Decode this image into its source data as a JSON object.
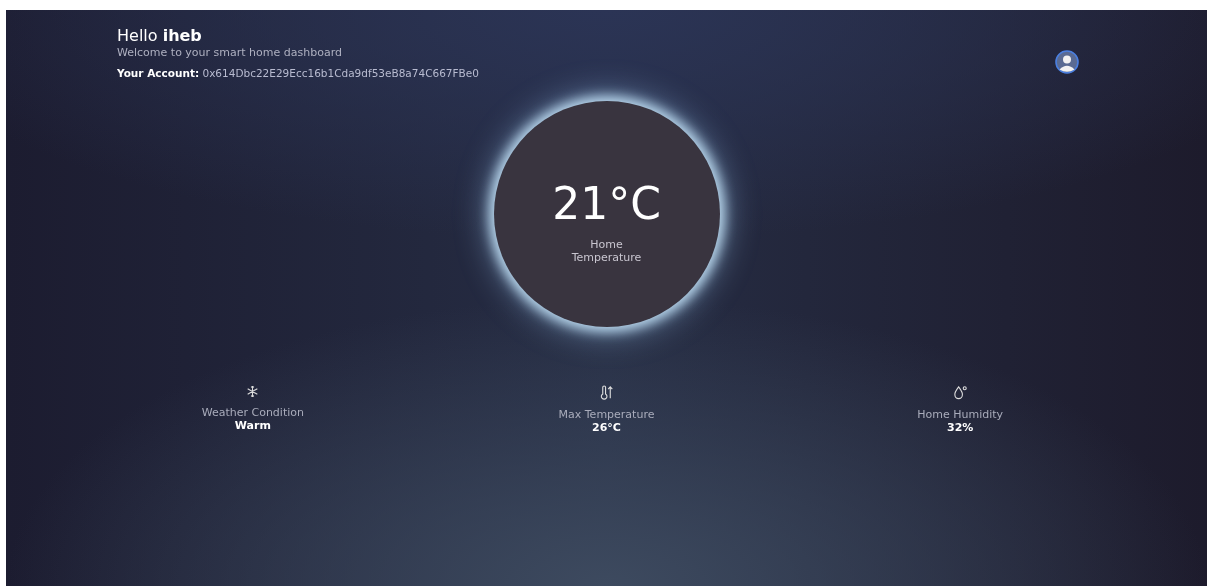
{
  "greeting": {
    "text": "Hello",
    "name": "iheb"
  },
  "subtitle": "Welcome to your smart home dashboard",
  "account": {
    "label": "Your Account:",
    "value": "0x614Dbc22E29Ecc16b1Cda9df53eB8a74C667FBe0"
  },
  "temperature": {
    "value": "21°C",
    "label": "Home Temperature"
  },
  "stats": [
    {
      "kind": "snow",
      "label": "Weather Condition",
      "value": "Warm"
    },
    {
      "kind": "thermo",
      "label": "Max Temperature",
      "value": "26°C"
    },
    {
      "kind": "drop",
      "label": "Home Humidity",
      "value": "32%"
    }
  ]
}
